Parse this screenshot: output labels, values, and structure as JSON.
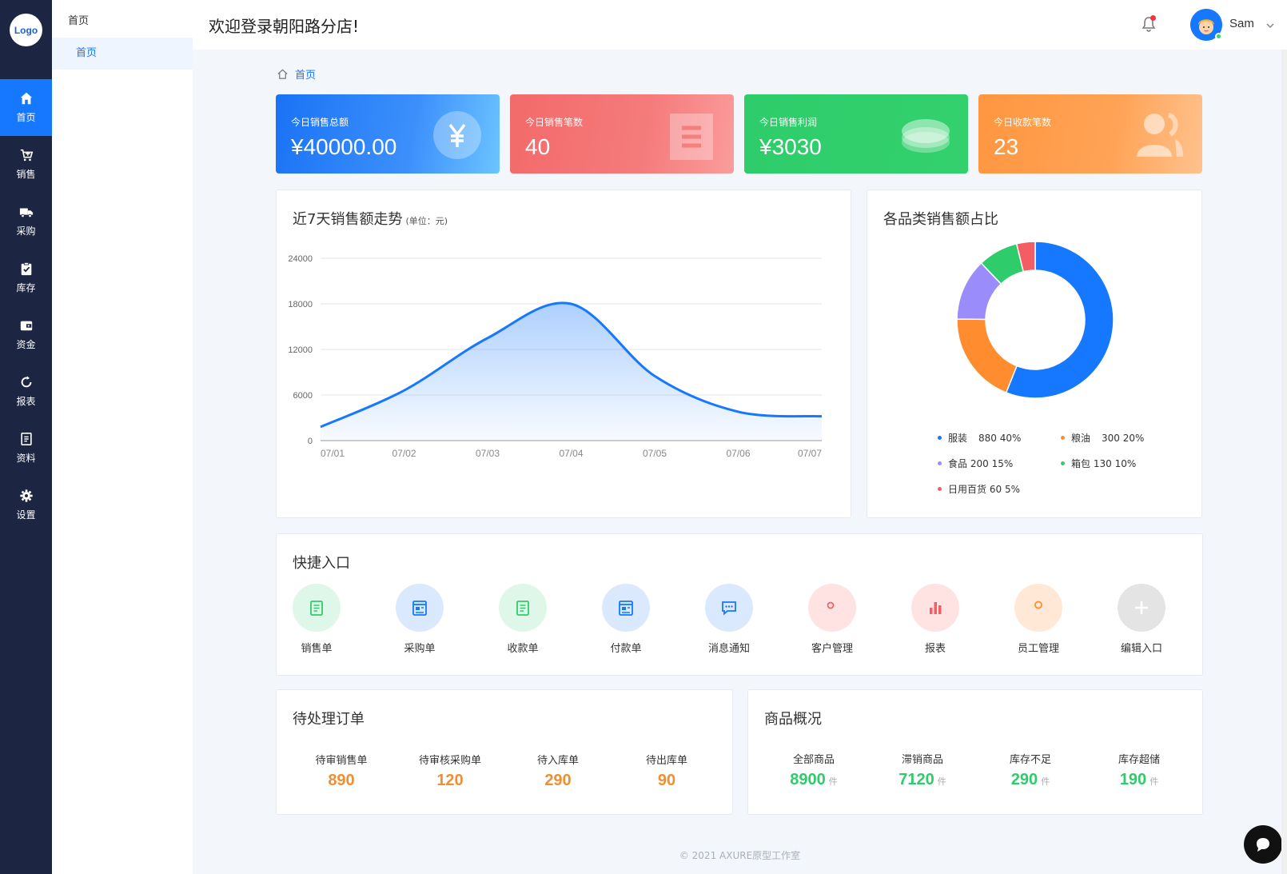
{
  "nav": {
    "logo": "Logo",
    "items": [
      {
        "label": "首页",
        "icon": "home-icon"
      },
      {
        "label": "销售",
        "icon": "cart-icon"
      },
      {
        "label": "采购",
        "icon": "truck-icon"
      },
      {
        "label": "库存",
        "icon": "clipboard-check-icon"
      },
      {
        "label": "资金",
        "icon": "wallet-icon"
      },
      {
        "label": "报表",
        "icon": "refresh-icon"
      },
      {
        "label": "资料",
        "icon": "document-icon"
      },
      {
        "label": "设置",
        "icon": "gear-icon"
      }
    ]
  },
  "subnav": {
    "title": "首页",
    "items": [
      {
        "label": "首页"
      }
    ]
  },
  "header": {
    "title": "欢迎登录朝阳路分店!",
    "username": "Sam"
  },
  "breadcrumb": {
    "home": "首页"
  },
  "kpis": [
    {
      "label": "今日销售总额",
      "value": "¥40000.00",
      "icon": "yen-icon"
    },
    {
      "label": "今日销售笔数",
      "value": "40",
      "icon": "list-icon"
    },
    {
      "label": "今日销售利润",
      "value": "¥3030",
      "icon": "coins-icon"
    },
    {
      "label": "今日收款笔数",
      "value": "23",
      "icon": "users-icon"
    }
  ],
  "line_chart_panel": {
    "title": "近7天销售额走势",
    "unit": "(单位：元)"
  },
  "pie_chart_panel": {
    "title": "各品类销售额占比"
  },
  "chart_data": [
    {
      "type": "area",
      "title": "近7天销售额走势",
      "x": [
        "07/01",
        "07/02",
        "07/03",
        "07/04",
        "07/05",
        "07/06",
        "07/07"
      ],
      "yticks": [
        "0",
        "6000",
        "12000",
        "18000",
        "24000"
      ],
      "ylim": [
        0,
        24000
      ],
      "series": [
        {
          "values": [
            1800,
            6600,
            13500,
            18000,
            8500,
            3800,
            3200
          ]
        }
      ],
      "color": "#1677ff",
      "grid": true
    },
    {
      "type": "pie",
      "title": "各品类销售额占比",
      "donut": true,
      "slices": [
        {
          "name": "服装",
          "value": 880,
          "percent": "40%",
          "color": "#1677ff"
        },
        {
          "name": "粮油",
          "value": 300,
          "percent": "20%",
          "color": "#ff8c2f"
        },
        {
          "name": "食品",
          "value": 200,
          "percent": "15%",
          "color": "#9b8cfb"
        },
        {
          "name": "箱包",
          "value": 130,
          "percent": "10%",
          "color": "#2ecc6a"
        },
        {
          "name": "日用百货",
          "value": 60,
          "percent": "5%",
          "color": "#f25e63"
        }
      ],
      "legend": "bottom"
    }
  ],
  "quick": {
    "title": "快捷入口",
    "items": [
      {
        "label": "销售单",
        "icon": "sales-order-icon",
        "bg": "#dff7e8",
        "fg": "#2ecc6a"
      },
      {
        "label": "采购单",
        "icon": "purchase-order-icon",
        "bg": "#dbe9ff",
        "fg": "#1677ff"
      },
      {
        "label": "收款单",
        "icon": "receipt-icon",
        "bg": "#dff7e8",
        "fg": "#2ecc6a"
      },
      {
        "label": "付款单",
        "icon": "payment-icon",
        "bg": "#dbe9ff",
        "fg": "#1677ff"
      },
      {
        "label": "消息通知",
        "icon": "message-icon",
        "bg": "#dbe9ff",
        "fg": "#1677ff"
      },
      {
        "label": "客户管理",
        "icon": "customers-icon",
        "bg": "#ffe3e3",
        "fg": "#f25e63"
      },
      {
        "label": "报表",
        "icon": "bar-chart-icon",
        "bg": "#ffe3e3",
        "fg": "#f25e63"
      },
      {
        "label": "员工管理",
        "icon": "employee-icon",
        "bg": "#ffe9d6",
        "fg": "#ff8c2f"
      },
      {
        "label": "编辑入口",
        "icon": "plus-icon",
        "bg": "#e4e4e4",
        "fg": "#ffffff"
      }
    ]
  },
  "orders": {
    "title": "待处理订单",
    "items": [
      {
        "label": "待审销售单",
        "value": "890"
      },
      {
        "label": "待审核采购单",
        "value": "120"
      },
      {
        "label": "待入库单",
        "value": "290"
      },
      {
        "label": "待出库单",
        "value": "90"
      }
    ]
  },
  "goods": {
    "title": "商品概况",
    "unit": "件",
    "items": [
      {
        "label": "全部商品",
        "value": "8900"
      },
      {
        "label": "滞销商品",
        "value": "7120"
      },
      {
        "label": "库存不足",
        "value": "290"
      },
      {
        "label": "库存超储",
        "value": "190"
      }
    ]
  },
  "footer": "© 2021   AXURE原型工作室"
}
